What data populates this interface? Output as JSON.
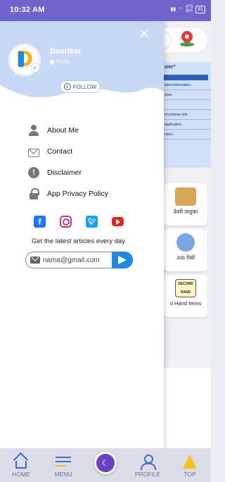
{
  "status_bar": {
    "time": "10:32 AM",
    "network_speed": "473",
    "network_unit": "B/S",
    "battery": "91"
  },
  "drawer": {
    "user": {
      "name": "Deorikar",
      "location": "India"
    },
    "follow_label": "FOLLOW",
    "menu": [
      {
        "label": "About Me",
        "icon": "person-icon"
      },
      {
        "label": "Contact",
        "icon": "mail-icon"
      },
      {
        "label": "Disclaimer",
        "icon": "info-icon"
      },
      {
        "label": "App Privacy Policy",
        "icon": "lock-icon"
      }
    ],
    "socials": [
      "facebook-icon",
      "instagram-icon",
      "twitter-icon",
      "youtube-icon"
    ],
    "newsletter": {
      "text": "Get the latest articles every day",
      "placeholder": "nama@gmail.com"
    }
  },
  "background": {
    "list_title": "sier\"",
    "list_lines": [
      "lated information.",
      "area",
      "",
      "nt scheme info.",
      "application.",
      "onics."
    ],
    "cards": [
      "देवरी तालुका",
      "Job देखो",
      "d Hand Items"
    ],
    "second_hand_sign": "SECOND HAND"
  },
  "bottom_nav": [
    "HOME",
    "MENU",
    "",
    "PROFILE",
    "TOP"
  ],
  "colors": {
    "status_bar": "#6f64cc",
    "drawer_header": "#c8d9f6",
    "accent_blue": "#3f68d6",
    "nav_bg": "#dcdde9"
  }
}
